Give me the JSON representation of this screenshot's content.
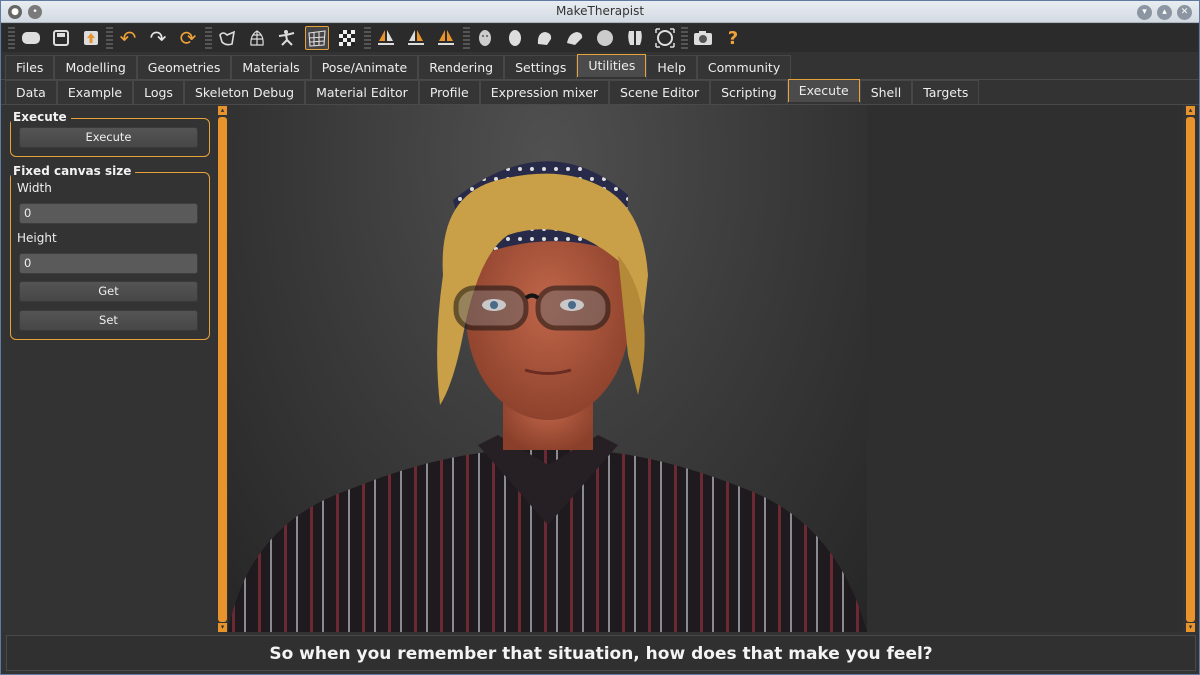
{
  "window": {
    "title": "MakeTherapist"
  },
  "toolbar": {
    "icons": [
      "file-new-icon",
      "save-icon",
      "export-icon",
      "undo-icon",
      "redo-icon",
      "reset-icon",
      "smooth-icon",
      "wireframe-icon",
      "pose-icon",
      "grid-icon",
      "checker-icon",
      "front-view-icon",
      "back-view-icon",
      "left-view-icon",
      "face-icon",
      "head-icon",
      "shoulder-icon",
      "hand-icon",
      "sphere-icon",
      "body-icon",
      "frame-icon",
      "camera-icon",
      "help-icon"
    ],
    "help_label": "?"
  },
  "tabs_main": [
    "Files",
    "Modelling",
    "Geometries",
    "Materials",
    "Pose/Animate",
    "Rendering",
    "Settings",
    "Utilities",
    "Help",
    "Community"
  ],
  "tabs_main_active": "Utilities",
  "tabs_sub": [
    "Data",
    "Example",
    "Logs",
    "Skeleton Debug",
    "Material Editor",
    "Profile",
    "Expression mixer",
    "Scene Editor",
    "Scripting",
    "Execute",
    "Shell",
    "Targets"
  ],
  "tabs_sub_active": "Execute",
  "execute_group": {
    "title": "Execute",
    "button": "Execute"
  },
  "canvas_group": {
    "title": "Fixed canvas size",
    "width_label": "Width",
    "width_value": "0",
    "height_label": "Height",
    "height_value": "0",
    "get_button": "Get",
    "set_button": "Set"
  },
  "status": {
    "message": "So when you remember that situation, how does that make you feel?"
  }
}
